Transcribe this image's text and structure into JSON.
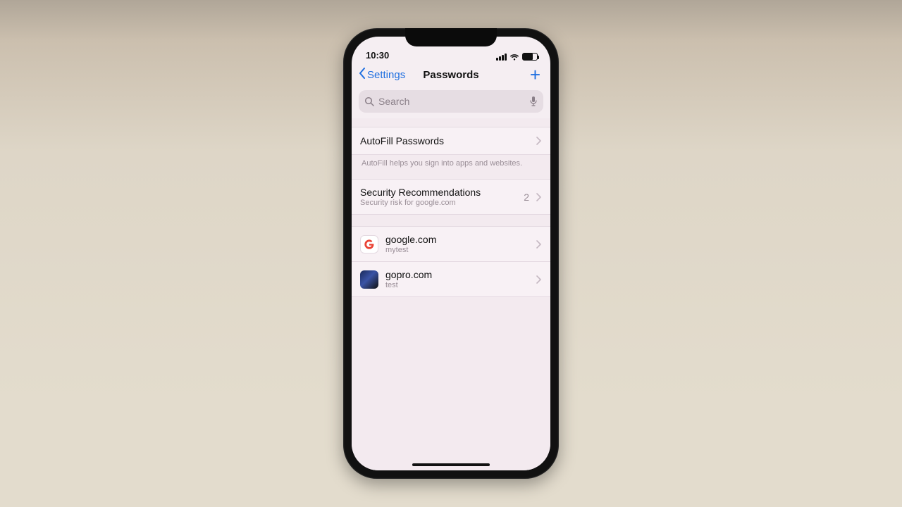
{
  "status": {
    "time": "10:30"
  },
  "nav": {
    "back_label": "Settings",
    "title": "Passwords",
    "add_label": "+"
  },
  "search": {
    "placeholder": "Search"
  },
  "autofill": {
    "title": "AutoFill Passwords",
    "footer": "AutoFill helps you sign into apps and websites."
  },
  "security": {
    "title": "Security Recommendations",
    "subtitle": "Security risk for google.com",
    "count": "2"
  },
  "entries": [
    {
      "site": "google.com",
      "user": "mytest",
      "icon": "google"
    },
    {
      "site": "gopro.com",
      "user": "test",
      "icon": "gopro"
    }
  ]
}
